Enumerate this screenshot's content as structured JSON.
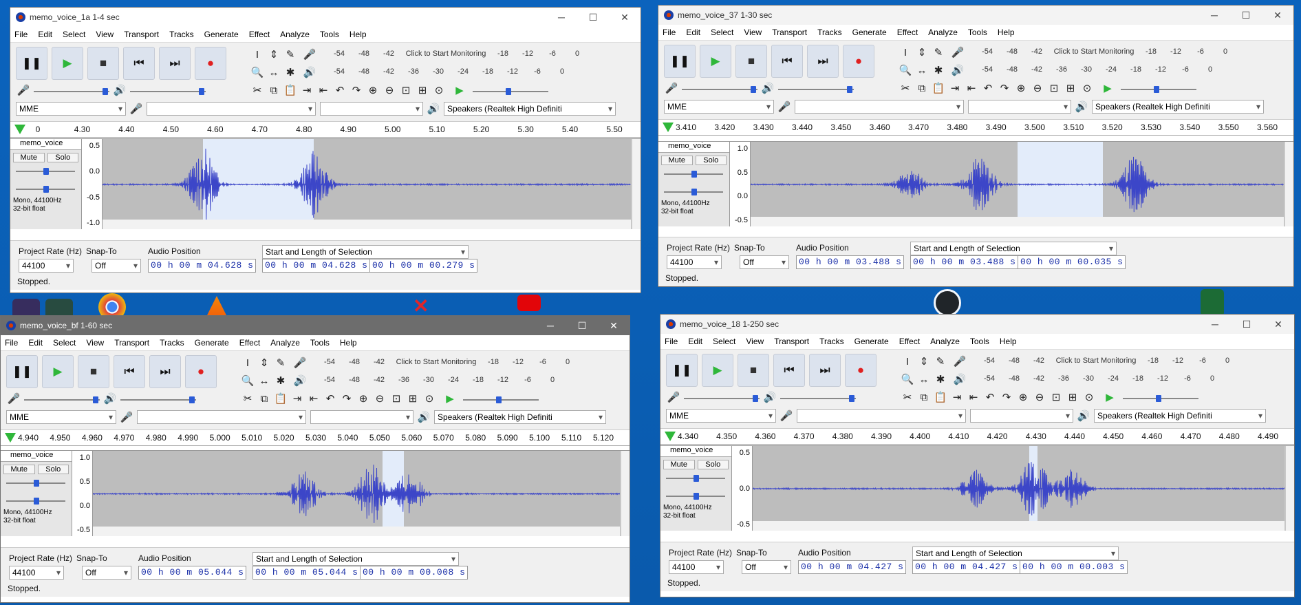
{
  "menus": [
    "File",
    "Edit",
    "Select",
    "View",
    "Transport",
    "Tracks",
    "Generate",
    "Effect",
    "Analyze",
    "Tools",
    "Help"
  ],
  "meter_text": "Click to Start Monitoring",
  "meter_ticks_top": [
    "-54",
    "-48",
    "-42",
    "-18",
    "-12",
    "-6",
    "0"
  ],
  "meter_ticks_bottom": [
    "-54",
    "-48",
    "-42",
    "-36",
    "-30",
    "-24",
    "-18",
    "-12",
    "-6",
    "0"
  ],
  "labels": {
    "project_rate": "Project Rate (Hz)",
    "snap_to": "Snap-To",
    "audio_position": "Audio Position",
    "selection_mode": "Start and Length of Selection",
    "stopped": "Stopped.",
    "host": "MME",
    "speakers": "Speakers (Realtek High Definiti",
    "rate_value": "44100",
    "snap_value": "Off",
    "mute": "Mute",
    "solo": "Solo",
    "track_info": "Mono, 44100Hz",
    "track_fmt": "32-bit float",
    "select": "Select"
  },
  "windows": [
    {
      "title": "memo_voice_1a 1-4 sec",
      "track_name": "memo_voice",
      "ruler": [
        "0",
        "4.30",
        "4.40",
        "4.50",
        "4.60",
        "4.70",
        "4.80",
        "4.90",
        "5.00",
        "5.10",
        "5.20",
        "5.30",
        "5.40",
        "5.50"
      ],
      "yaxis": [
        "0.5",
        "0.0",
        "-0.5",
        "-1.0"
      ],
      "audio_position": "00 h 00 m 04.628 s",
      "sel_start": "00 h 00 m 04.628 s",
      "sel_length": "00 h 00 m 00.279 s"
    },
    {
      "title": "memo_voice_37 1-30 sec",
      "track_name": "memo_voice",
      "ruler": [
        "3.410",
        "3.420",
        "3.430",
        "3.440",
        "3.450",
        "3.460",
        "3.470",
        "3.480",
        "3.490",
        "3.500",
        "3.510",
        "3.520",
        "3.530",
        "3.540",
        "3.550",
        "3.560"
      ],
      "yaxis": [
        "1.0",
        "0.5",
        "0.0",
        "-0.5"
      ],
      "audio_position": "00 h 00 m 03.488 s",
      "sel_start": "00 h 00 m 03.488 s",
      "sel_length": "00 h 00 m 00.035 s"
    },
    {
      "title": "memo_voice_bf 1-60 sec",
      "track_name": "memo_voice",
      "ruler": [
        "4.940",
        "4.950",
        "4.960",
        "4.970",
        "4.980",
        "4.990",
        "5.000",
        "5.010",
        "5.020",
        "5.030",
        "5.040",
        "5.050",
        "5.060",
        "5.070",
        "5.080",
        "5.090",
        "5.100",
        "5.110",
        "5.120"
      ],
      "yaxis": [
        "1.0",
        "0.5",
        "0.0",
        "-0.5"
      ],
      "audio_position": "00 h 00 m 05.044 s",
      "sel_start": "00 h 00 m 05.044 s",
      "sel_length": "00 h 00 m 00.008 s"
    },
    {
      "title": "memo_voice_18 1-250 sec",
      "track_name": "memo_voice",
      "ruler": [
        "4.340",
        "4.350",
        "4.360",
        "4.370",
        "4.380",
        "4.390",
        "4.400",
        "4.410",
        "4.420",
        "4.430",
        "4.440",
        "4.450",
        "4.460",
        "4.470",
        "4.480",
        "4.490"
      ],
      "yaxis": [
        "0.5",
        "0.0",
        "-0.5"
      ],
      "audio_position": "00 h 00 m 04.427 s",
      "sel_start": "00 h 00 m 04.427 s",
      "sel_length": "00 h 00 m 00.003 s"
    }
  ],
  "colors": {
    "wave": "#3c46c8",
    "selection": "#e3ecfa",
    "play": "#2fb73a",
    "record": "#e02020",
    "time_text": "#1a2fa8"
  }
}
